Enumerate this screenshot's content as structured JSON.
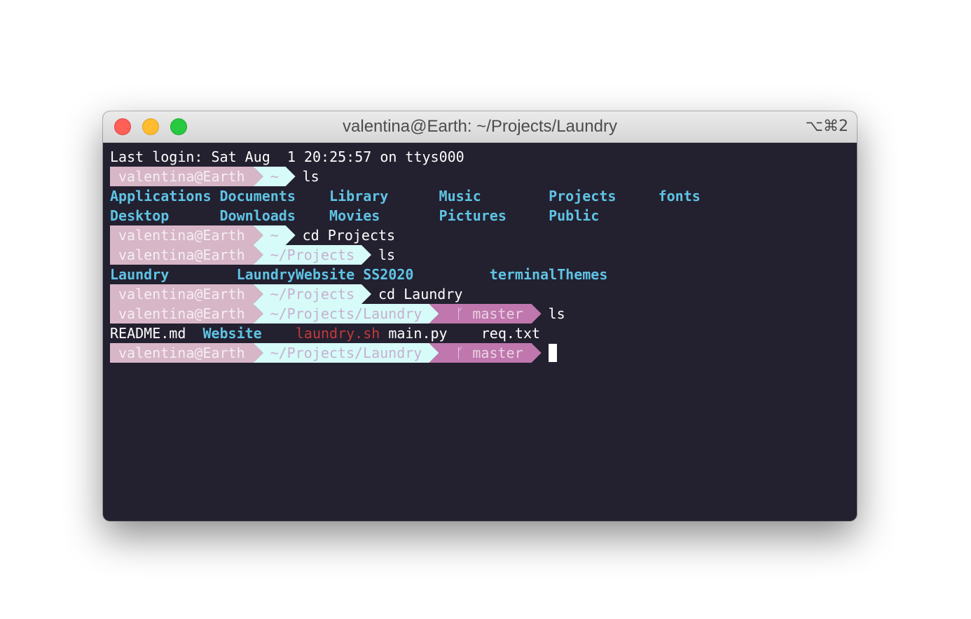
{
  "window": {
    "title": "valentina@Earth: ~/Projects/Laundry",
    "shortcut": "⌥⌘2"
  },
  "colors": {
    "background": "#23202f",
    "user_segment": "#d7b6c7",
    "path_segment": "#d6fbf8",
    "git_segment": "#bf77ad",
    "directory": "#5fc3e4",
    "executable": "#c43a3a"
  },
  "terminal": {
    "login": "Last login: Sat Aug  1 20:25:57 on ttys000",
    "prompt_user": "valentina@Earth",
    "git_branch_icon": "git-branch-icon",
    "git_branch": "master",
    "home_listing": {
      "row1": [
        "Applications",
        "Documents",
        "Library",
        "Music",
        "Projects",
        "fonts"
      ],
      "row2": [
        "Desktop",
        "Downloads",
        "Movies",
        "Pictures",
        "Public"
      ]
    },
    "projects_listing": [
      "Laundry",
      "LaundryWebsite",
      "SS2020",
      "terminalThemes"
    ],
    "laundry_listing": [
      {
        "name": "README.md",
        "kind": "file"
      },
      {
        "name": "Website",
        "kind": "dir"
      },
      {
        "name": "laundry.sh",
        "kind": "exe"
      },
      {
        "name": "main.py",
        "kind": "file"
      },
      {
        "name": "req.txt",
        "kind": "file"
      }
    ],
    "prompts": [
      {
        "path": "~",
        "command": "ls"
      },
      {
        "path": "~",
        "command": "cd Projects"
      },
      {
        "path": "~/Projects",
        "command": "ls"
      },
      {
        "path": "~/Projects",
        "command": "cd Laundry"
      },
      {
        "path": "~/Projects/Laundry",
        "command": "ls"
      },
      {
        "path": "~/Projects/Laundry",
        "command": ""
      }
    ]
  }
}
